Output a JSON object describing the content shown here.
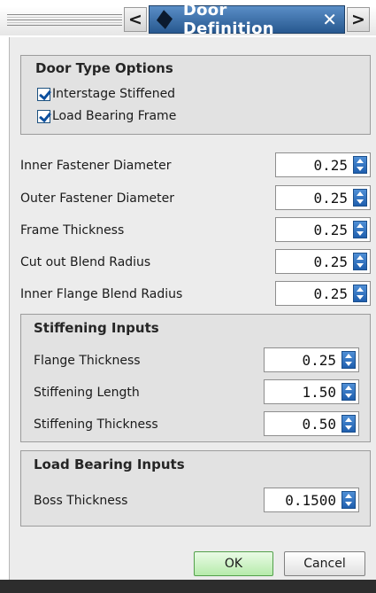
{
  "titlebar": {
    "title": "Door Definition",
    "prev_glyph": "<",
    "next_glyph": ">",
    "close_glyph": "✕"
  },
  "door_type_options": {
    "title": "Door Type Options",
    "checkboxes": [
      {
        "label": "Interstage Stiffened",
        "checked": true
      },
      {
        "label": "Load Bearing Frame",
        "checked": true
      }
    ]
  },
  "fields": [
    {
      "label": "Inner Fastener Diameter",
      "value": "0.25"
    },
    {
      "label": "Outer Fastener Diameter",
      "value": "0.25"
    },
    {
      "label": "Frame Thickness",
      "value": "0.25"
    },
    {
      "label": "Cut out Blend Radius",
      "value": "0.25"
    },
    {
      "label": "Inner Flange Blend Radius",
      "value": "0.25"
    }
  ],
  "stiffening_inputs": {
    "title": "Stiffening Inputs",
    "fields": [
      {
        "label": "Flange Thickness",
        "value": "0.25"
      },
      {
        "label": "Stiffening Length",
        "value": "1.50"
      },
      {
        "label": "Stiffening Thickness",
        "value": "0.50"
      }
    ]
  },
  "load_bearing_inputs": {
    "title": "Load Bearing Inputs",
    "fields": [
      {
        "label": "Boss Thickness",
        "value": "0.1500"
      }
    ]
  },
  "buttons": {
    "ok": "OK",
    "cancel": "Cancel"
  },
  "colors": {
    "title_bar": "#3f76b3",
    "ok_button": "#b6ebab",
    "spinner": "#2a6fc0"
  }
}
